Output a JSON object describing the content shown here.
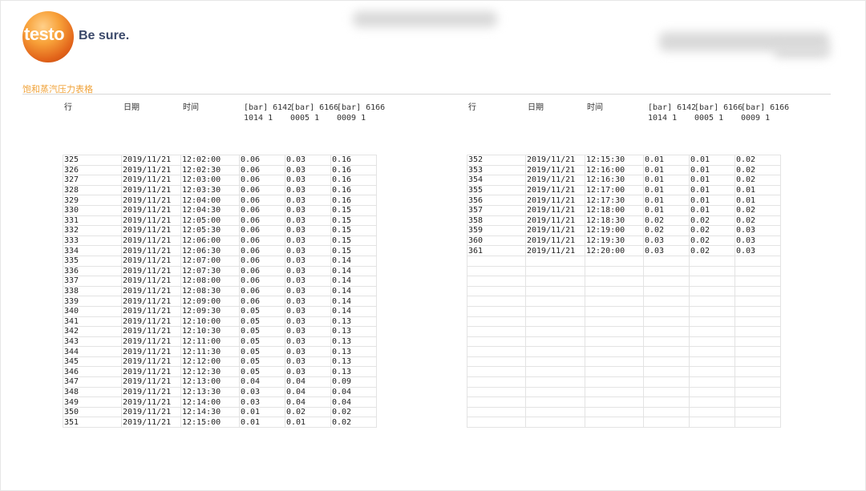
{
  "brand": {
    "logo_text": "testo",
    "tagline": "Be sure."
  },
  "sheet_title": "饱和蒸汽压力表格",
  "headers": {
    "row": "行",
    "date": "日期",
    "time": "时间",
    "ch1_a": "[bar] 6142",
    "ch1_b": "1014 1",
    "ch2_a": "[bar] 6166",
    "ch2_b": "0005 1",
    "ch3_a": "[bar] 6166",
    "ch3_b": "0009 1"
  },
  "left_rows": [
    [
      "325",
      "2019/11/21",
      "12:02:00",
      "0.06",
      "0.03",
      "0.16"
    ],
    [
      "326",
      "2019/11/21",
      "12:02:30",
      "0.06",
      "0.03",
      "0.16"
    ],
    [
      "327",
      "2019/11/21",
      "12:03:00",
      "0.06",
      "0.03",
      "0.16"
    ],
    [
      "328",
      "2019/11/21",
      "12:03:30",
      "0.06",
      "0.03",
      "0.16"
    ],
    [
      "329",
      "2019/11/21",
      "12:04:00",
      "0.06",
      "0.03",
      "0.16"
    ],
    [
      "330",
      "2019/11/21",
      "12:04:30",
      "0.06",
      "0.03",
      "0.15"
    ],
    [
      "331",
      "2019/11/21",
      "12:05:00",
      "0.06",
      "0.03",
      "0.15"
    ],
    [
      "332",
      "2019/11/21",
      "12:05:30",
      "0.06",
      "0.03",
      "0.15"
    ],
    [
      "333",
      "2019/11/21",
      "12:06:00",
      "0.06",
      "0.03",
      "0.15"
    ],
    [
      "334",
      "2019/11/21",
      "12:06:30",
      "0.06",
      "0.03",
      "0.15"
    ],
    [
      "335",
      "2019/11/21",
      "12:07:00",
      "0.06",
      "0.03",
      "0.14"
    ],
    [
      "336",
      "2019/11/21",
      "12:07:30",
      "0.06",
      "0.03",
      "0.14"
    ],
    [
      "337",
      "2019/11/21",
      "12:08:00",
      "0.06",
      "0.03",
      "0.14"
    ],
    [
      "338",
      "2019/11/21",
      "12:08:30",
      "0.06",
      "0.03",
      "0.14"
    ],
    [
      "339",
      "2019/11/21",
      "12:09:00",
      "0.06",
      "0.03",
      "0.14"
    ],
    [
      "340",
      "2019/11/21",
      "12:09:30",
      "0.05",
      "0.03",
      "0.14"
    ],
    [
      "341",
      "2019/11/21",
      "12:10:00",
      "0.05",
      "0.03",
      "0.13"
    ],
    [
      "342",
      "2019/11/21",
      "12:10:30",
      "0.05",
      "0.03",
      "0.13"
    ],
    [
      "343",
      "2019/11/21",
      "12:11:00",
      "0.05",
      "0.03",
      "0.13"
    ],
    [
      "344",
      "2019/11/21",
      "12:11:30",
      "0.05",
      "0.03",
      "0.13"
    ],
    [
      "345",
      "2019/11/21",
      "12:12:00",
      "0.05",
      "0.03",
      "0.13"
    ],
    [
      "346",
      "2019/11/21",
      "12:12:30",
      "0.05",
      "0.03",
      "0.13"
    ],
    [
      "347",
      "2019/11/21",
      "12:13:00",
      "0.04",
      "0.04",
      "0.09"
    ],
    [
      "348",
      "2019/11/21",
      "12:13:30",
      "0.03",
      "0.04",
      "0.04"
    ],
    [
      "349",
      "2019/11/21",
      "12:14:00",
      "0.03",
      "0.04",
      "0.04"
    ],
    [
      "350",
      "2019/11/21",
      "12:14:30",
      "0.01",
      "0.02",
      "0.02"
    ],
    [
      "351",
      "2019/11/21",
      "12:15:00",
      "0.01",
      "0.01",
      "0.02"
    ]
  ],
  "right_rows": [
    [
      "352",
      "2019/11/21",
      "12:15:30",
      "0.01",
      "0.01",
      "0.02"
    ],
    [
      "353",
      "2019/11/21",
      "12:16:00",
      "0.01",
      "0.01",
      "0.02"
    ],
    [
      "354",
      "2019/11/21",
      "12:16:30",
      "0.01",
      "0.01",
      "0.02"
    ],
    [
      "355",
      "2019/11/21",
      "12:17:00",
      "0.01",
      "0.01",
      "0.01"
    ],
    [
      "356",
      "2019/11/21",
      "12:17:30",
      "0.01",
      "0.01",
      "0.01"
    ],
    [
      "357",
      "2019/11/21",
      "12:18:00",
      "0.01",
      "0.01",
      "0.02"
    ],
    [
      "358",
      "2019/11/21",
      "12:18:30",
      "0.02",
      "0.02",
      "0.02"
    ],
    [
      "359",
      "2019/11/21",
      "12:19:00",
      "0.02",
      "0.02",
      "0.03"
    ],
    [
      "360",
      "2019/11/21",
      "12:19:30",
      "0.03",
      "0.02",
      "0.03"
    ],
    [
      "361",
      "2019/11/21",
      "12:20:00",
      "0.03",
      "0.02",
      "0.03"
    ]
  ]
}
